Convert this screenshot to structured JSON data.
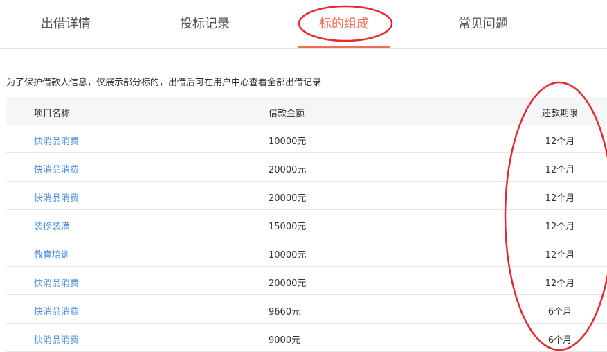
{
  "tabs": [
    {
      "label": "出借详情"
    },
    {
      "label": "投标记录"
    },
    {
      "label": "标的组成",
      "active": true
    },
    {
      "label": "常见问题"
    }
  ],
  "notice": "为了保护借款人信息，仅展示部分标的，出借后可在用户中心查看全部出借记录",
  "table": {
    "headers": [
      "项目名称",
      "借款金额",
      "还款期限"
    ],
    "rows": [
      [
        "快消品消费",
        "10000元",
        "12个月"
      ],
      [
        "快消品消费",
        "20000元",
        "12个月"
      ],
      [
        "快消品消费",
        "20000元",
        "12个月"
      ],
      [
        "装修装潢",
        "15000元",
        "12个月"
      ],
      [
        "教育培训",
        "10000元",
        "12个月"
      ],
      [
        "快消品消费",
        "20000元",
        "12个月"
      ],
      [
        "快消品消费",
        "9660元",
        "6个月"
      ],
      [
        "快消品消费",
        "9000元",
        "6个月"
      ]
    ]
  },
  "colors": {
    "accent": "#ee6f54",
    "link": "#4a90e2",
    "annotation": "#e8282b"
  }
}
